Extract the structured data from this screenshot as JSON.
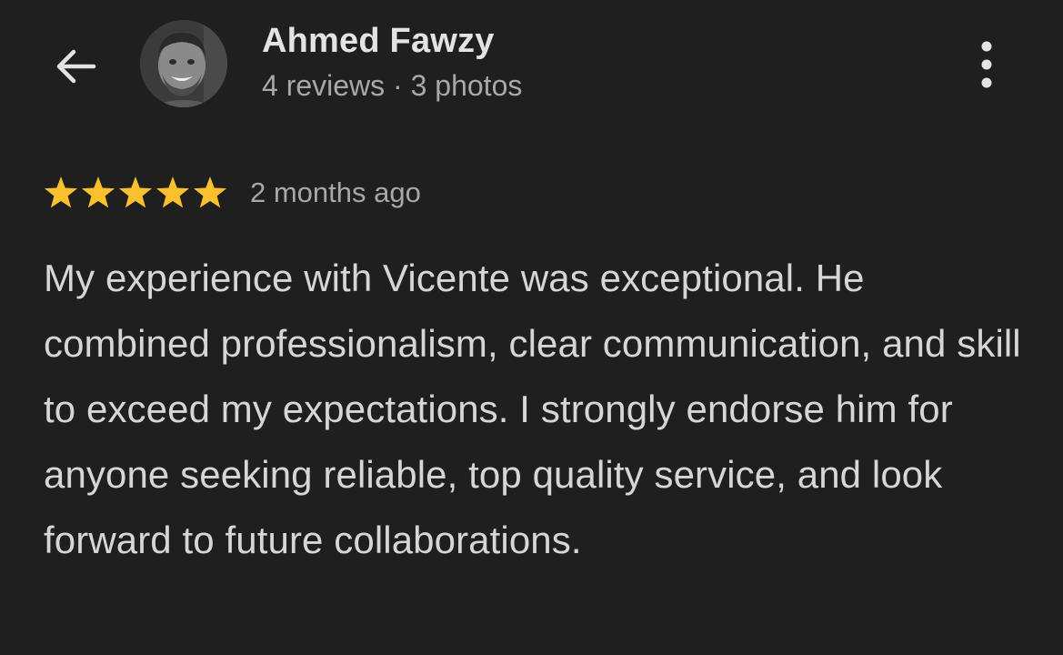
{
  "header": {
    "back_icon": "arrow-left-icon",
    "more_icon": "more-vertical-icon"
  },
  "author": {
    "name": "Ahmed Fawzy",
    "stats": "4 reviews · 3 photos"
  },
  "review": {
    "rating": 5,
    "rating_max": 5,
    "date": "2 months ago",
    "text": "My experience with Vicente was exceptional. He combined professionalism, clear communication, and skill to exceed my expectations. I strongly endorse him for anyone seeking reliable, top quality service, and look forward to future collaborations."
  },
  "colors": {
    "background": "#1f1f1f",
    "text_primary": "#e3e3e3",
    "text_secondary": "#a8a8a8",
    "star": "#fbc02d"
  }
}
